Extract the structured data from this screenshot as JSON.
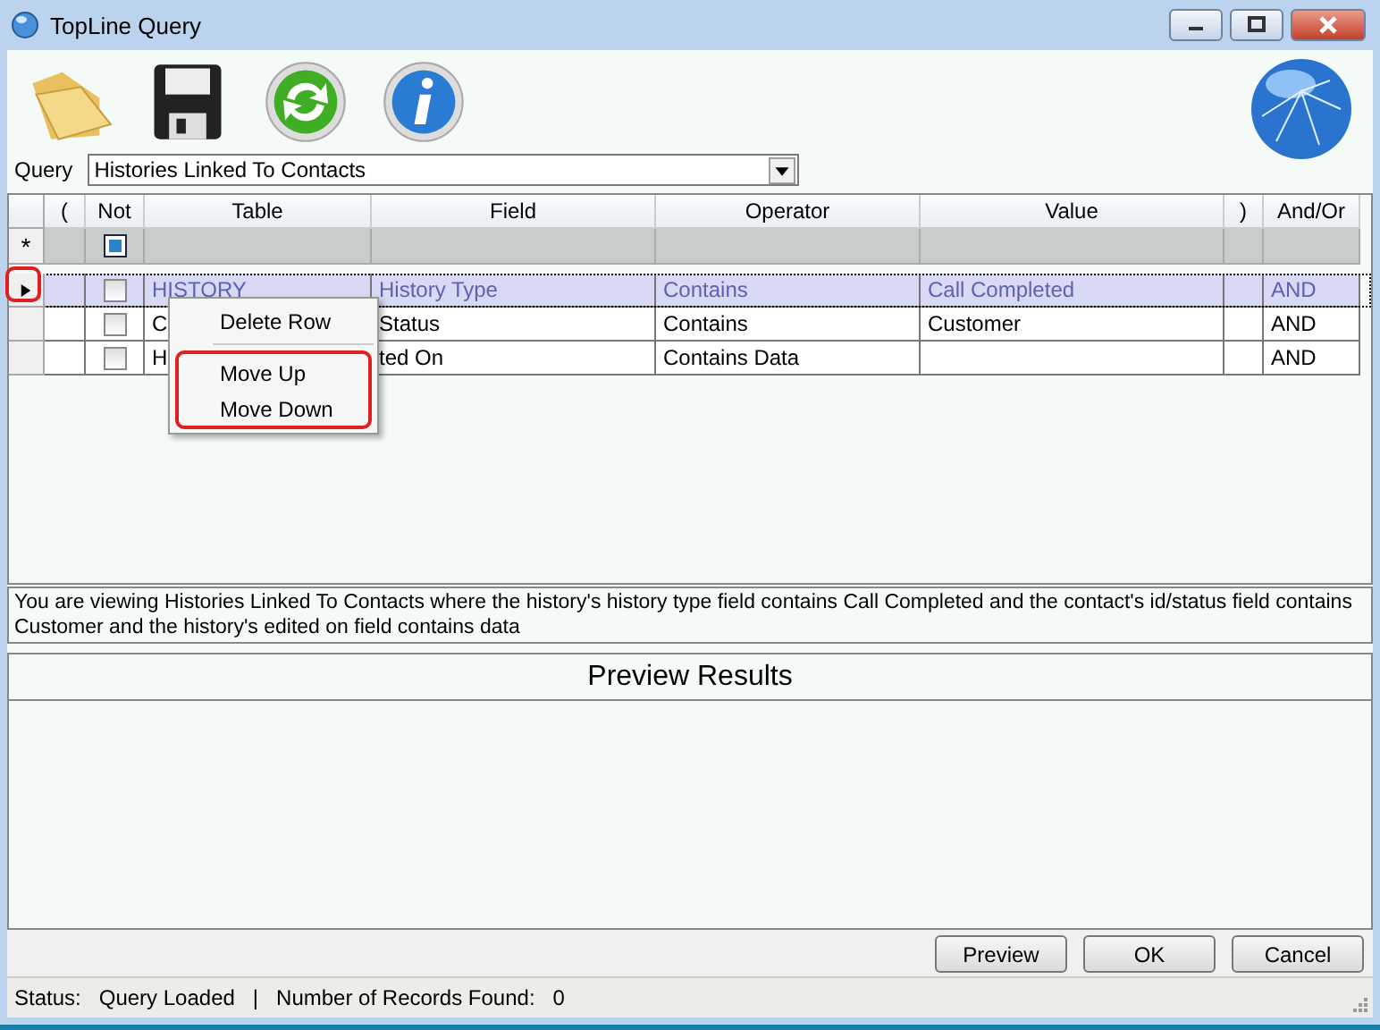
{
  "window": {
    "title": "TopLine Query"
  },
  "query": {
    "label": "Query",
    "value": "Histories Linked To Contacts"
  },
  "grid": {
    "columns": [
      "(",
      "Not",
      "Table",
      "Field",
      "Operator",
      "Value",
      ")",
      "And/Or"
    ],
    "new_row": {
      "marker": "*",
      "not_checked": true
    },
    "rows": [
      {
        "selected": true,
        "current": true,
        "marked": true,
        "not_checked": false,
        "open": "",
        "table": "HISTORY",
        "field": "History Type",
        "operator": "Contains",
        "value": "Call Completed",
        "close": "",
        "andor": "AND"
      },
      {
        "selected": false,
        "current": false,
        "marked": false,
        "not_checked": false,
        "open": "",
        "table": "C",
        "field": "Status",
        "operator": "Contains",
        "value": "Customer",
        "close": "",
        "andor": "AND"
      },
      {
        "selected": false,
        "current": false,
        "marked": false,
        "not_checked": false,
        "open": "",
        "table": "H",
        "field": "ted On",
        "operator": "Contains Data",
        "value": "",
        "close": "",
        "andor": "AND"
      }
    ]
  },
  "context_menu": {
    "sections": [
      {
        "marked": false,
        "items": [
          "Delete Row"
        ]
      },
      {
        "marked": true,
        "items": [
          "Move Up",
          "Move Down"
        ]
      }
    ]
  },
  "description": "You are viewing Histories Linked To Contacts where the history's history type field contains Call Completed and the contact's id/status field contains Customer and the history's edited on field contains data",
  "preview": {
    "title": "Preview Results"
  },
  "buttons": [
    "Preview",
    "OK",
    "Cancel"
  ],
  "status_bar": {
    "label": "Status:",
    "status": "Query Loaded",
    "separator": "|",
    "records_label": "Number of Records Found:",
    "records": "0"
  }
}
